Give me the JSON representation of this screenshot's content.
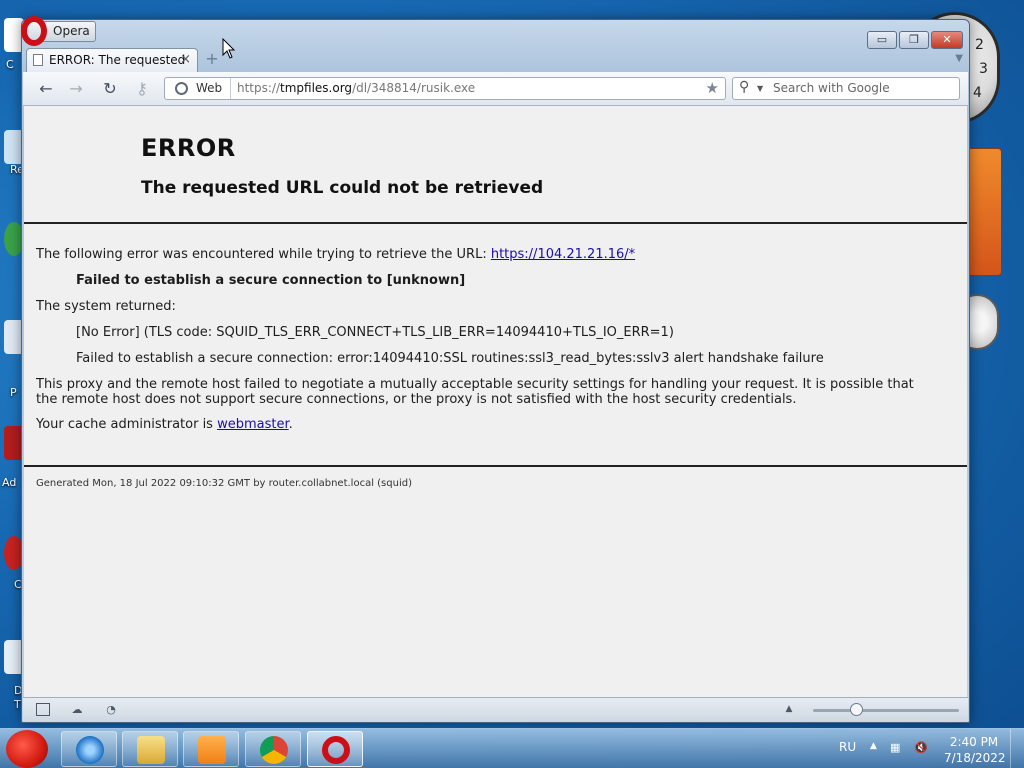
{
  "browser": {
    "app_button_label": "Opera",
    "tab_title": "ERROR: The requested ...",
    "tab_close": "×",
    "new_tab": "+",
    "nav_back": "←",
    "nav_forward": "→",
    "nav_reload": "↻",
    "nav_key": "⚷",
    "address_mode": "Web",
    "address_scheme": "https://",
    "address_host": "tmpfiles.org",
    "address_path": "/dl/348814/rusik.exe",
    "search_placeholder": "Search with Google",
    "window_minimize": "▭",
    "window_maximize": "❐",
    "window_close": "✕"
  },
  "page": {
    "heading": "ERROR",
    "subheading": "The requested URL could not be retrieved",
    "intro_text": "The following error was encountered while trying to retrieve the URL: ",
    "intro_link": "https://104.21.21.16/*",
    "failure": "Failed to establish a secure connection to [unknown]",
    "system_returned": "The system returned:",
    "tls_code": "[No Error] (TLS code: SQUID_TLS_ERR_CONNECT+TLS_LIB_ERR=14094410+TLS_IO_ERR=1)",
    "ssl_error": "Failed to establish a secure connection: error:14094410:SSL routines:ssl3_read_bytes:sslv3 alert handshake failure",
    "explanation": "This proxy and the remote host failed to negotiate a mutually acceptable security settings for handling your request. It is possible that the remote host does not support secure connections, or the proxy is not satisfied with the host security credentials.",
    "admin_prefix": "Your cache administrator is ",
    "admin_link": "webmaster",
    "admin_suffix": ".",
    "generated": "Generated Mon, 18 Jul 2022 09:10:32 GMT by router.collabnet.local (squid)"
  },
  "statusbar": {
    "zoom_level_fraction": 0.3
  },
  "taskbar": {
    "language": "RU",
    "time": "2:40 PM",
    "date": "7/18/2022",
    "apps": [
      "internet-explorer",
      "file-explorer",
      "media-player",
      "chrome",
      "opera"
    ]
  },
  "desktop": {
    "icon_labels": [
      "C",
      "Re",
      "P",
      "Ad",
      "C",
      "D",
      "T"
    ],
    "clock_numbers": [
      "2",
      "3",
      "4"
    ]
  },
  "colors": {
    "link": "#1a0dab",
    "opera_red": "#cc0f16",
    "desktop_blue": "#1769b3"
  }
}
